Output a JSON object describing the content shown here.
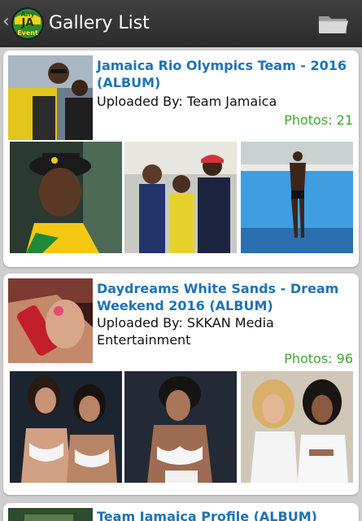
{
  "app": {
    "title": "Gallery List",
    "logo_text_top": "Any",
    "logo_text_mid": "JA",
    "logo_text_bottom": "Event",
    "back_icon": "chevron-left-icon",
    "folder_icon": "folder-icon"
  },
  "albums": [
    {
      "title": "Jamaica Rio Olympics Team - 2016 (ALBUM)",
      "uploaded_by": "Uploaded By: Team Jamaica",
      "photos": "Photos: 21"
    },
    {
      "title": "Daydreams White Sands - Dream Weekend 2016 (ALBUM)",
      "uploaded_by": "Uploaded By: SKKAN Media Entertainment",
      "photos": "Photos: 96"
    },
    {
      "title": "Team Jamaica Profile (ALBUM)"
    }
  ],
  "colors": {
    "title_blue": "#1e73b4",
    "photos_green": "#3aab2e",
    "actionbar": "#333333",
    "background": "#cfcfcf"
  }
}
